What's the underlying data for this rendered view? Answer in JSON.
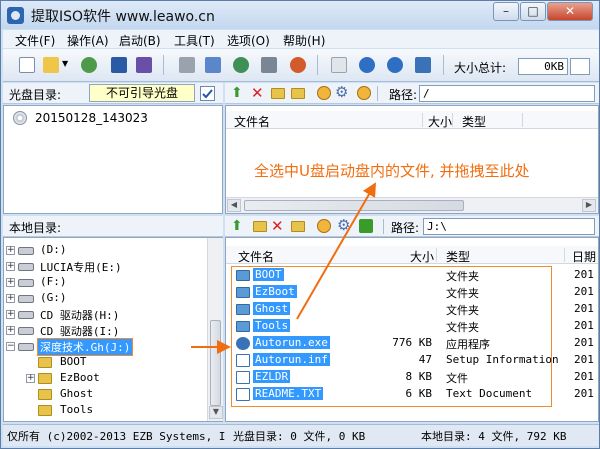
{
  "window": {
    "title": "提取ISO软件 www.leawo.cn",
    "min_label": "–",
    "max_label": "□",
    "close_label": "✕"
  },
  "menu": [
    "文件(F)",
    "操作(A)",
    "启动(B)",
    "工具(T)",
    "选项(O)",
    "帮助(H)"
  ],
  "toolbar": {
    "size_label": "大小总计:",
    "size_value": "0KB"
  },
  "disc": {
    "label": "光盘目录:",
    "boot_status": "不可引导光盘",
    "tree_item": "20150128_143023",
    "path_label": "路径:",
    "path_value": "/",
    "columns": [
      "文件名",
      "大小",
      "类型"
    ]
  },
  "annotation": "全选中U盘启动盘内的文件, 并拖拽至此处",
  "local": {
    "label": "本地目录:",
    "path_label": "路径:",
    "path_value": "J:\\",
    "tree": [
      {
        "label": "(D:)",
        "kind": "drive"
      },
      {
        "label": "LUCIA专用(E:)",
        "kind": "drive"
      },
      {
        "label": "(F:)",
        "kind": "drive"
      },
      {
        "label": "(G:)",
        "kind": "drive"
      },
      {
        "label": "CD 驱动器(H:)",
        "kind": "cd"
      },
      {
        "label": "CD 驱动器(I:)",
        "kind": "cd"
      },
      {
        "label": "深度技术.Gh(J:)",
        "kind": "usb"
      },
      {
        "label": "BOOT",
        "kind": "folder"
      },
      {
        "label": "EzBoot",
        "kind": "folder"
      },
      {
        "label": "Ghost",
        "kind": "folder"
      },
      {
        "label": "Tools",
        "kind": "folder"
      }
    ],
    "columns": [
      "文件名",
      "大小",
      "类型",
      "日期"
    ],
    "files": [
      {
        "name": "BOOT",
        "size": "",
        "type": "文件夹",
        "date": "201",
        "icon": "folder-icon"
      },
      {
        "name": "EzBoot",
        "size": "",
        "type": "文件夹",
        "date": "201",
        "icon": "folder-icon"
      },
      {
        "name": "Ghost",
        "size": "",
        "type": "文件夹",
        "date": "201",
        "icon": "folder-icon"
      },
      {
        "name": "Tools",
        "size": "",
        "type": "文件夹",
        "date": "201",
        "icon": "folder-icon"
      },
      {
        "name": "Autorun.exe",
        "size": "776 KB",
        "type": "应用程序",
        "date": "201",
        "icon": "app-icon"
      },
      {
        "name": "Autorun.inf",
        "size": "47",
        "type": "Setup Information",
        "date": "201",
        "icon": "settings-file-icon"
      },
      {
        "name": "EZLDR",
        "size": "8 KB",
        "type": "文件",
        "date": "201",
        "icon": "file-icon"
      },
      {
        "name": "README.TXT",
        "size": "6 KB",
        "type": "Text Document",
        "date": "201",
        "icon": "text-file-icon"
      }
    ]
  },
  "status": {
    "copyright": "仅所有 (c)2002-2013 EZB Systems, I",
    "disc_count": "光盘目录: 0 文件, 0 KB",
    "local_count": "本地目录: 4 文件, 792 KB"
  },
  "colors": {
    "accent": "#f26d0f",
    "selection": "#3399ff",
    "frame": "#cfe0f3"
  }
}
